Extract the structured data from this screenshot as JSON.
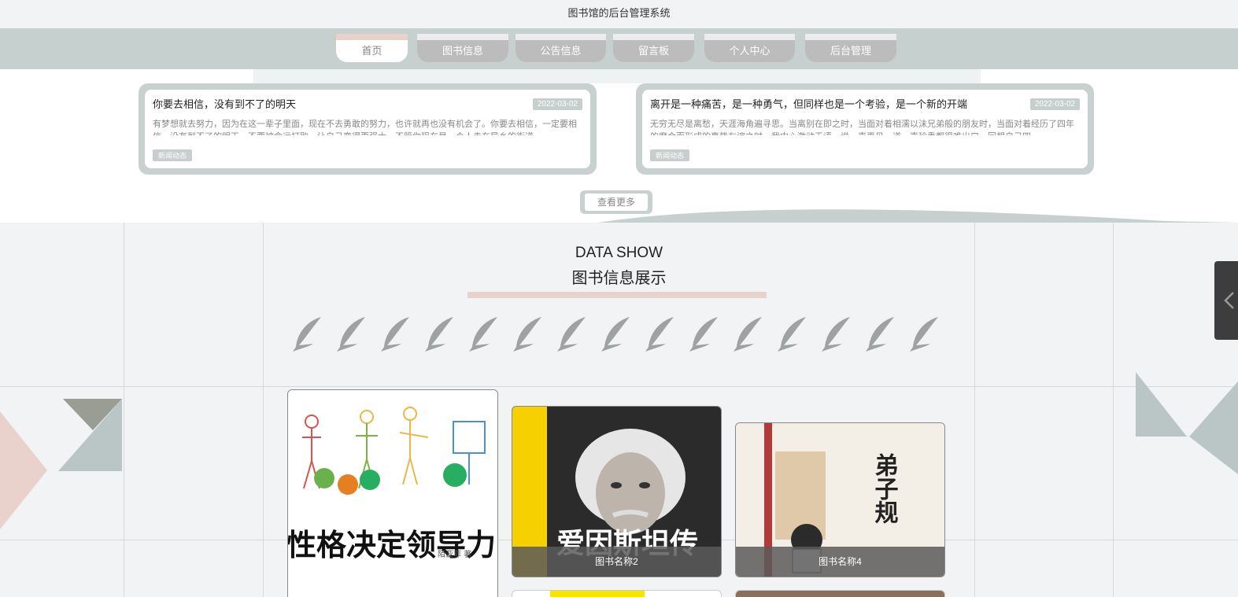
{
  "header": {
    "title": "图书馆的后台管理系统"
  },
  "nav": {
    "tabs": [
      {
        "label": "首页",
        "active": true
      },
      {
        "label": "图书信息",
        "active": false
      },
      {
        "label": "公告信息",
        "active": false
      },
      {
        "label": "留言板",
        "active": false
      },
      {
        "label": "个人中心",
        "active": false
      },
      {
        "label": "后台管理",
        "active": false
      }
    ]
  },
  "news": [
    {
      "title": "你要去相信，没有到不了的明天",
      "date": "2022-03-02",
      "excerpt": "有梦想就去努力，因为在这一辈子里面，现在不去勇敢的努力，也许就再也没有机会了。你要去相信，一定要相信，没有到不了的明天。不要被命运打败，让自己变得更强大。不管你现在是一个人走在异乡的街道",
      "tag": "新闻动态"
    },
    {
      "title": "离开是一种痛苦，是一种勇气，但同样也是一个考验，是一个新的开端",
      "date": "2022-03-02",
      "excerpt": "无穷无尽是离愁，天涯海角遍寻思。当离别在即之时，当面对着相濡以沫兄弟般的朋友时，当面对着经历了四年的磨合而形成的真挚友谊之时，我内心激动无语，说一声再见，道一声珍重都很难出口，回想自己四",
      "tag": "新闻动态"
    }
  ],
  "more_button": {
    "label": "查看更多"
  },
  "data_show": {
    "title_en": "DATA SHOW",
    "title_cn": "图书信息展示",
    "books": [
      {
        "name": "",
        "cover_title": "性格决定领导力",
        "cover_author": "陌亚菲 著"
      },
      {
        "name": "图书名称2",
        "cover_title": "爱因斯坦传"
      },
      {
        "name": "图书名称4",
        "cover_title": "弟子规"
      }
    ]
  },
  "colors": {
    "accent_pink": "#e9d2cb",
    "accent_grey_green": "#c6d0cf",
    "tab_grey": "#bcbcbc"
  },
  "icons": {
    "feather": "feather-icon",
    "side_handle": "chevron-left-icon"
  }
}
